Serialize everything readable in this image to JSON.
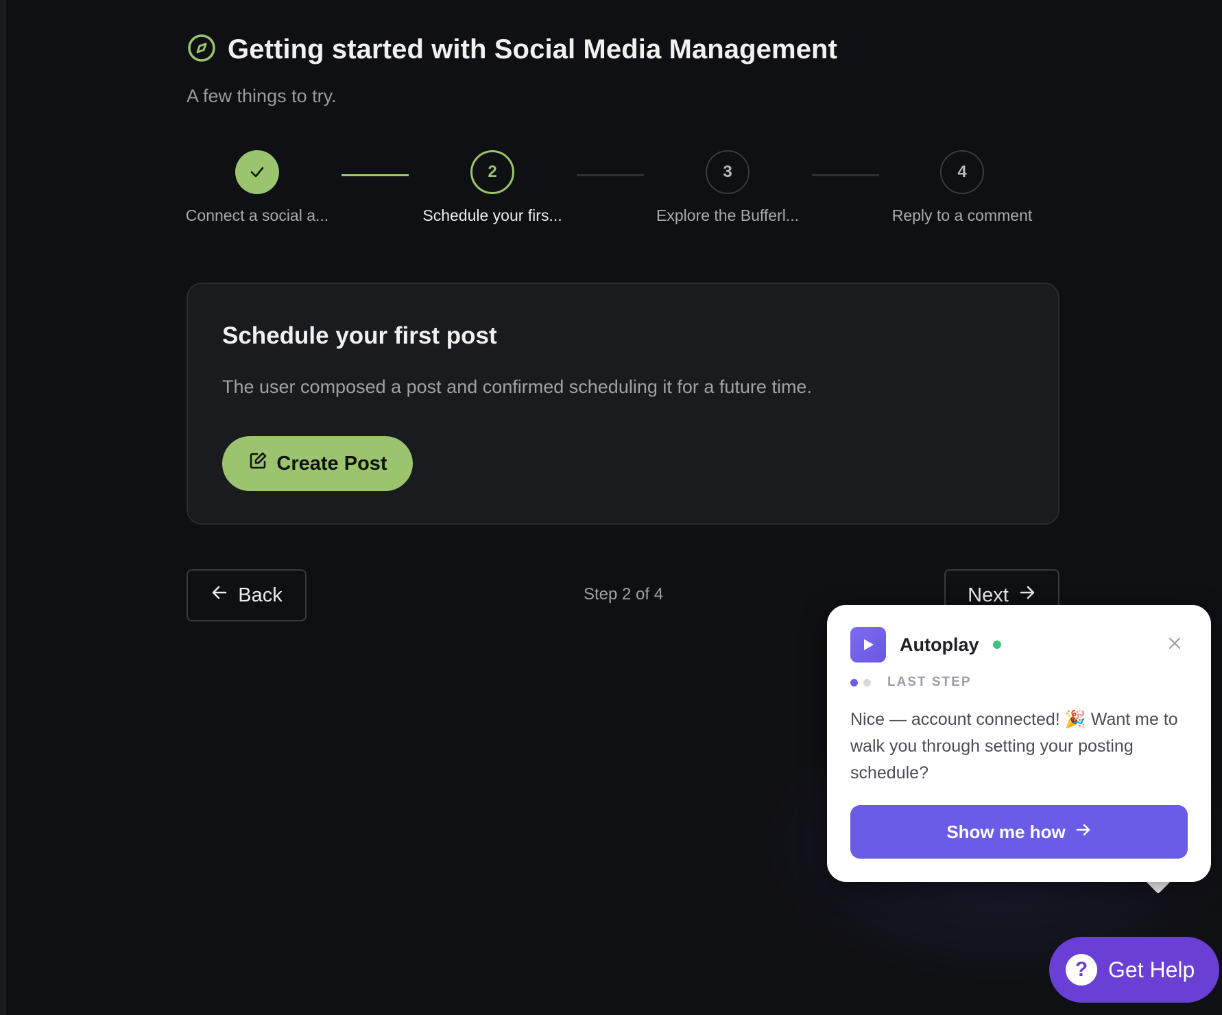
{
  "header": {
    "title": "Getting started with Social Media Management",
    "subtitle": "A few things to try.",
    "icon": "compass-icon"
  },
  "colors": {
    "accent": "#9bc46f",
    "background": "#0f1013",
    "card": "#1a1b1e",
    "popup_accent": "#6b5ce7",
    "help": "#6a3fd6"
  },
  "stepper": {
    "steps": [
      {
        "number": "",
        "label": "Connect a social a...",
        "state": "done"
      },
      {
        "number": "2",
        "label": "Schedule your firs...",
        "state": "active"
      },
      {
        "number": "3",
        "label": "Explore the Bufferl...",
        "state": "todo"
      },
      {
        "number": "4",
        "label": "Reply to a comment",
        "state": "todo"
      }
    ]
  },
  "card": {
    "title": "Schedule your first post",
    "description": "The user composed a post and confirmed scheduling it for a future time.",
    "button_label": "Create Post"
  },
  "nav": {
    "back_label": "Back",
    "step_count": "Step 2 of 4",
    "next_label": "Next"
  },
  "popup": {
    "app_name": "Autoplay",
    "status": "online",
    "progress_label": "LAST STEP",
    "message": "Nice — account connected! 🎉 Want me to walk you through setting your posting schedule?",
    "cta_label": "Show me how"
  },
  "help": {
    "label": "Get Help"
  }
}
